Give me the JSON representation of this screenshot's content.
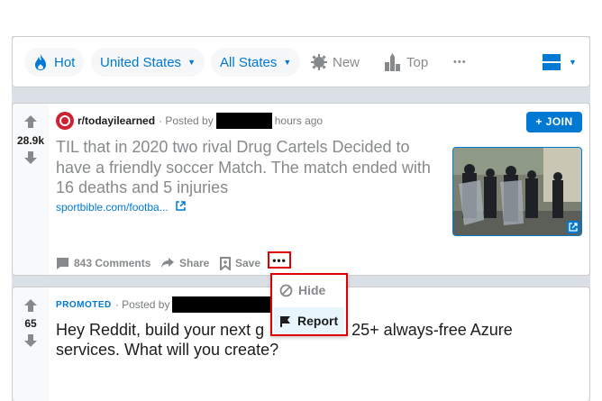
{
  "sortbar": {
    "hot": "Hot",
    "country": "United States",
    "region": "All States",
    "new": "New",
    "top": "Top",
    "more": "•••",
    "accent": "#0079d3"
  },
  "post1": {
    "score": "28.9k",
    "subreddit": "r/todayilearned",
    "posted_by": "· Posted by",
    "time": "hours ago",
    "join": "+ JOIN",
    "title": "TIL that in 2020 two rival Drug Cartels Decided to have a friendly soccer Match. The match ended with 16 deaths and 5 injuries",
    "link": "sportbible.com/footba...",
    "comments": "843 Comments",
    "share": "Share",
    "save": "Save",
    "more": "•••"
  },
  "menu": {
    "hide": "Hide",
    "report": "Report"
  },
  "post2": {
    "score": "65",
    "promoted": "PROMOTED",
    "posted_by": "· Posted by",
    "title": "Hey Reddit, build your next g[redacted]ith 25+ always-free Azure services. What will you create?",
    "title_visible_a": "Hey Reddit, build your next g",
    "title_visible_b": "ith 25+ always-free Azure",
    "title_line2": "services. What will you create?"
  }
}
